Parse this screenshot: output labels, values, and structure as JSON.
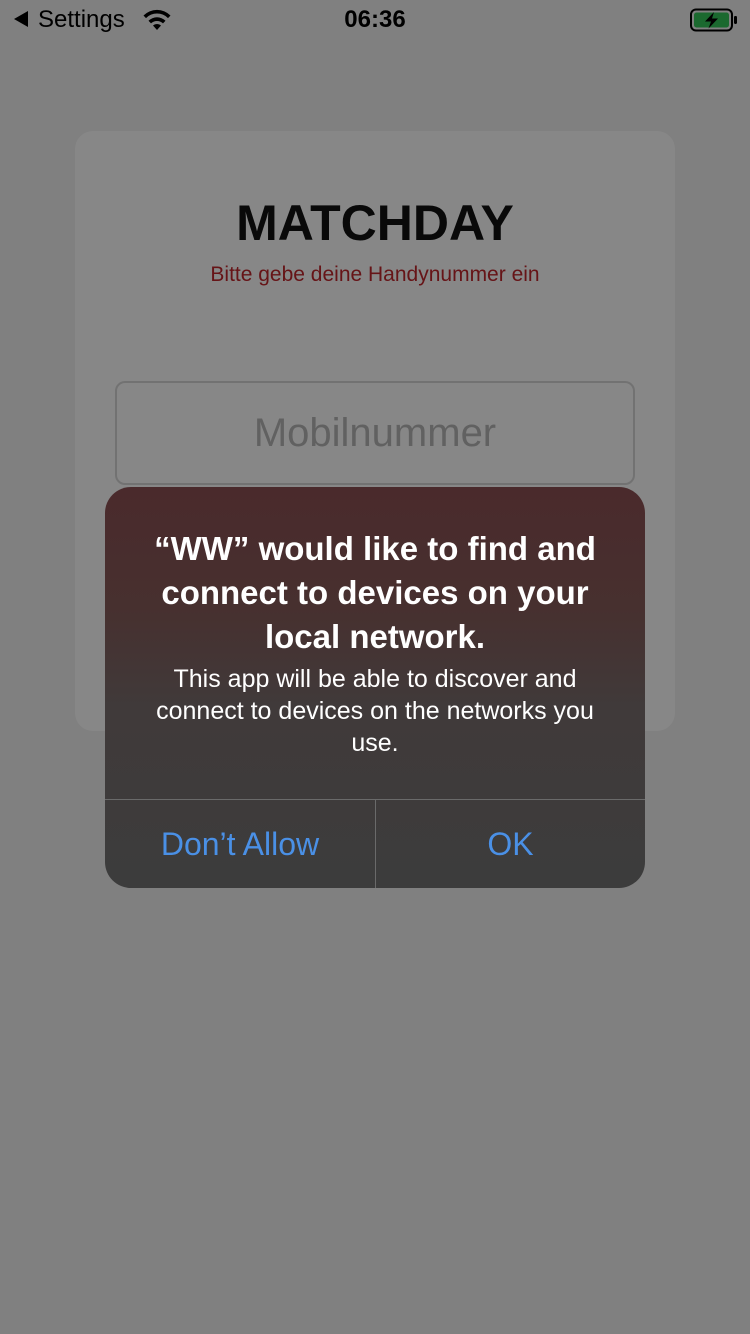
{
  "status_bar": {
    "back_label": "Settings",
    "time": "06:36",
    "wifi_icon": "wifi-icon",
    "battery_icon": "battery-charging-icon",
    "battery_color": "#34c759"
  },
  "login": {
    "title": "MATCHDAY",
    "subtitle": "Bitte gebe deine Handynummer ein",
    "phone_placeholder": "Mobilnummer",
    "subtitle_color": "#c0262c"
  },
  "alert": {
    "title": "“WW” would like to find and connect to devices on your local network.",
    "message": "This app will be able to discover and connect to devices on the networks you use.",
    "buttons": {
      "dont_allow": "Don’t Allow",
      "ok": "OK"
    },
    "button_color": "#4a90e6"
  }
}
